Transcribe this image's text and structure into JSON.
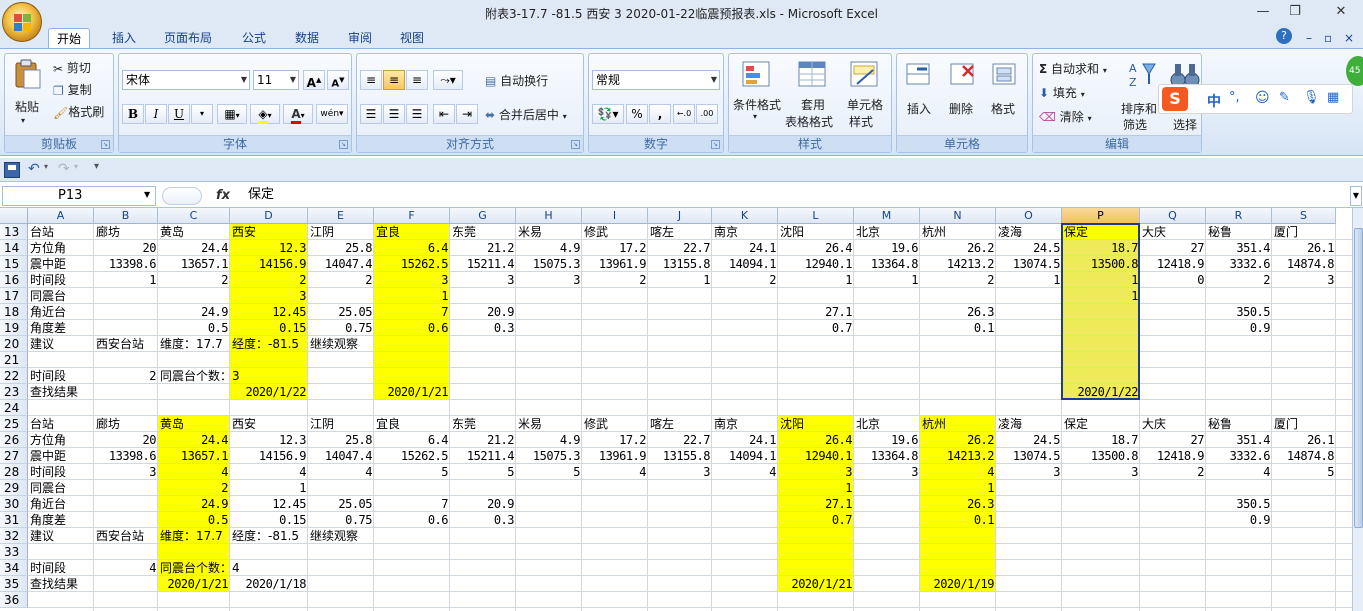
{
  "window": {
    "title": "附表3-17.7 -81.5 西安 3 2020-01-22临震预报表.xls - Microsoft Excel",
    "minimize": "—",
    "restore": "❐",
    "close": "✕"
  },
  "tabs": [
    "开始",
    "插入",
    "页面布局",
    "公式",
    "数据",
    "审阅",
    "视图"
  ],
  "ribbon": {
    "clipboard": {
      "label": "剪贴板",
      "paste": "粘贴",
      "cut": "剪切",
      "copy": "复制",
      "format_painter": "格式刷"
    },
    "font": {
      "label": "字体",
      "name": "宋体",
      "size": "11",
      "grow": "A",
      "shrink": "A",
      "bold": "B",
      "italic": "I",
      "underline": "U",
      "phonetic": "wén"
    },
    "align": {
      "label": "对齐方式",
      "wrap": "自动换行",
      "merge": "合并后居中"
    },
    "number": {
      "label": "数字",
      "format": "常规",
      "percent": "%",
      "comma": ",",
      "inc_dec": "←.0",
      "dec_dec": ".00"
    },
    "styles": {
      "label": "样式",
      "cond": "条件格式",
      "table_fmt": [
        "套用",
        "表格格式"
      ],
      "cell_style": [
        "单元格",
        "样式"
      ]
    },
    "cells": {
      "label": "单元格",
      "insert": "插入",
      "delete": "删除",
      "format": "格式"
    },
    "editing": {
      "label": "编辑",
      "autosum": "自动求和",
      "fill": "填充",
      "clear": "清除",
      "sort": [
        "排序和",
        "筛选"
      ],
      "find": [
        "查找和",
        "选择"
      ]
    }
  },
  "ime": {
    "mode": "中",
    "punct": "°,"
  },
  "formula_bar": {
    "name_box": "P13",
    "fx": "fx",
    "value": "保定"
  },
  "colors": {
    "highlight": "#ffff00",
    "selection": "#eeeb59",
    "sel_border": "#1f3a93"
  },
  "columns": [
    "A",
    "B",
    "C",
    "D",
    "E",
    "F",
    "G",
    "H",
    "I",
    "J",
    "K",
    "L",
    "M",
    "N",
    "O",
    "P",
    "Q",
    "R",
    "S"
  ],
  "rows": [
    {
      "n": "13",
      "cells": [
        "台站",
        "廊坊",
        "黄岛",
        "西安",
        "江阴",
        "宜良",
        "东莞",
        "米易",
        "修武",
        "喀左",
        "南京",
        "沈阳",
        "北京",
        "杭州",
        "凌海",
        "保定",
        "大庆",
        "秘鲁",
        "厦门"
      ]
    },
    {
      "n": "14",
      "cells": [
        "方位角",
        "20",
        "24.4",
        "12.3",
        "25.8",
        "6.4",
        "21.2",
        "4.9",
        "17.2",
        "22.7",
        "24.1",
        "26.4",
        "19.6",
        "26.2",
        "24.5",
        "18.7",
        "27",
        "351.4",
        "26.1"
      ]
    },
    {
      "n": "15",
      "cells": [
        "震中距",
        "13398.6",
        "13657.1",
        "14156.9",
        "14047.4",
        "15262.5",
        "15211.4",
        "15075.3",
        "13961.9",
        "13155.8",
        "14094.1",
        "12940.1",
        "13364.8",
        "14213.2",
        "13074.5",
        "13500.8",
        "12418.9",
        "3332.6",
        "14874.8"
      ]
    },
    {
      "n": "16",
      "cells": [
        "时间段",
        "1",
        "2",
        "2",
        "2",
        "3",
        "3",
        "3",
        "2",
        "1",
        "2",
        "1",
        "1",
        "2",
        "1",
        "1",
        "0",
        "2",
        "3"
      ]
    },
    {
      "n": "17",
      "cells": [
        "同震台",
        "",
        "",
        "3",
        "",
        "1",
        "",
        "",
        "",
        "",
        "",
        "",
        "",
        "",
        "",
        "1",
        "",
        "",
        ""
      ]
    },
    {
      "n": "18",
      "cells": [
        "角近台",
        "",
        "24.9",
        "12.45",
        "25.05",
        "7",
        "20.9",
        "",
        "",
        "",
        "",
        "27.1",
        "",
        "26.3",
        "",
        "",
        "",
        "350.5",
        ""
      ]
    },
    {
      "n": "19",
      "cells": [
        "角度差",
        "",
        "0.5",
        "0.15",
        "0.75",
        "0.6",
        "0.3",
        "",
        "",
        "",
        "",
        "0.7",
        "",
        "0.1",
        "",
        "",
        "",
        "0.9",
        ""
      ]
    },
    {
      "n": "20",
      "cells": [
        "建议",
        "西安台站",
        "维度：17.7",
        "经度：-81.5",
        "继续观察",
        "",
        "",
        "",
        "",
        "",
        "",
        "",
        "",
        "",
        "",
        "",
        "",
        "",
        ""
      ]
    },
    {
      "n": "21",
      "cells": [
        "",
        "",
        "",
        "",
        "",
        "",
        "",
        "",
        "",
        "",
        "",
        "",
        "",
        "",
        "",
        "",
        "",
        "",
        ""
      ]
    },
    {
      "n": "22",
      "cells": [
        "时间段",
        "2",
        "同震台个数：3",
        "",
        "",
        "",
        "",
        "",
        "",
        "",
        "",
        "",
        "",
        "",
        "",
        "",
        "",
        "",
        ""
      ]
    },
    {
      "n": "23",
      "cells": [
        "查找结果",
        "",
        "",
        "2020/1/22",
        "",
        "2020/1/21",
        "",
        "",
        "",
        "",
        "",
        "",
        "",
        "",
        "",
        "2020/1/22",
        "",
        "",
        ""
      ]
    },
    {
      "n": "24",
      "cells": [
        "",
        "",
        "",
        "",
        "",
        "",
        "",
        "",
        "",
        "",
        "",
        "",
        "",
        "",
        "",
        "",
        "",
        "",
        ""
      ]
    },
    {
      "n": "25",
      "cells": [
        "台站",
        "廊坊",
        "黄岛",
        "西安",
        "江阴",
        "宜良",
        "东莞",
        "米易",
        "修武",
        "喀左",
        "南京",
        "沈阳",
        "北京",
        "杭州",
        "凌海",
        "保定",
        "大庆",
        "秘鲁",
        "厦门"
      ]
    },
    {
      "n": "26",
      "cells": [
        "方位角",
        "20",
        "24.4",
        "12.3",
        "25.8",
        "6.4",
        "21.2",
        "4.9",
        "17.2",
        "22.7",
        "24.1",
        "26.4",
        "19.6",
        "26.2",
        "24.5",
        "18.7",
        "27",
        "351.4",
        "26.1"
      ]
    },
    {
      "n": "27",
      "cells": [
        "震中距",
        "13398.6",
        "13657.1",
        "14156.9",
        "14047.4",
        "15262.5",
        "15211.4",
        "15075.3",
        "13961.9",
        "13155.8",
        "14094.1",
        "12940.1",
        "13364.8",
        "14213.2",
        "13074.5",
        "13500.8",
        "12418.9",
        "3332.6",
        "14874.8"
      ]
    },
    {
      "n": "28",
      "cells": [
        "时间段",
        "3",
        "4",
        "4",
        "4",
        "5",
        "5",
        "5",
        "4",
        "3",
        "4",
        "3",
        "3",
        "4",
        "3",
        "3",
        "2",
        "4",
        "5"
      ]
    },
    {
      "n": "29",
      "cells": [
        "同震台",
        "",
        "2",
        "1",
        "",
        "",
        "",
        "",
        "",
        "",
        "",
        "1",
        "",
        "1",
        "",
        "",
        "",
        "",
        ""
      ]
    },
    {
      "n": "30",
      "cells": [
        "角近台",
        "",
        "24.9",
        "12.45",
        "25.05",
        "7",
        "20.9",
        "",
        "",
        "",
        "",
        "27.1",
        "",
        "26.3",
        "",
        "",
        "",
        "350.5",
        ""
      ]
    },
    {
      "n": "31",
      "cells": [
        "角度差",
        "",
        "0.5",
        "0.15",
        "0.75",
        "0.6",
        "0.3",
        "",
        "",
        "",
        "",
        "0.7",
        "",
        "0.1",
        "",
        "",
        "",
        "0.9",
        ""
      ]
    },
    {
      "n": "32",
      "cells": [
        "建议",
        "西安台站",
        "维度：17.7",
        "经度：-81.5",
        "继续观察",
        "",
        "",
        "",
        "",
        "",
        "",
        "",
        "",
        "",
        "",
        "",
        "",
        "",
        ""
      ]
    },
    {
      "n": "33",
      "cells": [
        "",
        "",
        "",
        "",
        "",
        "",
        "",
        "",
        "",
        "",
        "",
        "",
        "",
        "",
        "",
        "",
        "",
        "",
        ""
      ]
    },
    {
      "n": "34",
      "cells": [
        "时间段",
        "4",
        "同震台个数：4",
        "",
        "",
        "",
        "",
        "",
        "",
        "",
        "",
        "",
        "",
        "",
        "",
        "",
        "",
        "",
        ""
      ]
    },
    {
      "n": "35",
      "cells": [
        "查找结果",
        "",
        "2020/1/21",
        "2020/1/18",
        "",
        "",
        "",
        "",
        "",
        "",
        "",
        "2020/1/21",
        "",
        "2020/1/19",
        "",
        "",
        "",
        "",
        ""
      ]
    },
    {
      "n": "36",
      "cells": [
        "",
        "",
        "",
        "",
        "",
        "",
        "",
        "",
        "",
        "",
        "",
        "",
        "",
        "",
        "",
        "",
        "",
        "",
        ""
      ]
    }
  ]
}
